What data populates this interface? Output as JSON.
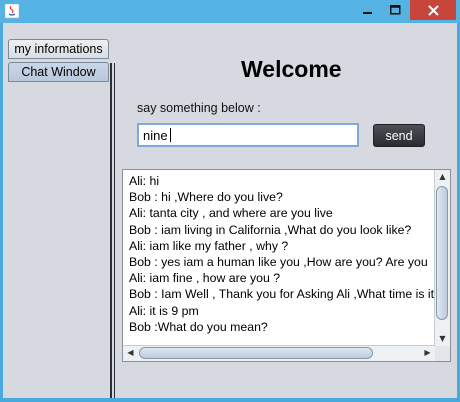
{
  "window": {
    "minimize_icon": "minimize-icon",
    "maximize_icon": "maximize-icon",
    "close_icon": "close-icon",
    "close_color": "#c7453b",
    "titlebar_color": "#55b3e3"
  },
  "tabs": [
    {
      "label": "my informations"
    },
    {
      "label": "Chat Window"
    }
  ],
  "main": {
    "title": "Welcome",
    "prompt": "say something below :",
    "input_value": "nine",
    "send_label": "send"
  },
  "chat": {
    "lines": [
      "Ali: hi",
      "Bob :  hi  ,Where do you live?",
      "Ali: tanta city , and where are you live",
      "Bob : iam living   in California  ,What do you look like?",
      "Ali: iam like my father , why ?",
      "Bob :  yes iam a human like you   ,How are you? Are you",
      "Ali: iam fine , how are you ?",
      "Bob :  Iam Well , Thank you for Asking Ali ,What time is it",
      "Ali: it is 9 pm",
      "Bob :What do you mean?"
    ]
  }
}
